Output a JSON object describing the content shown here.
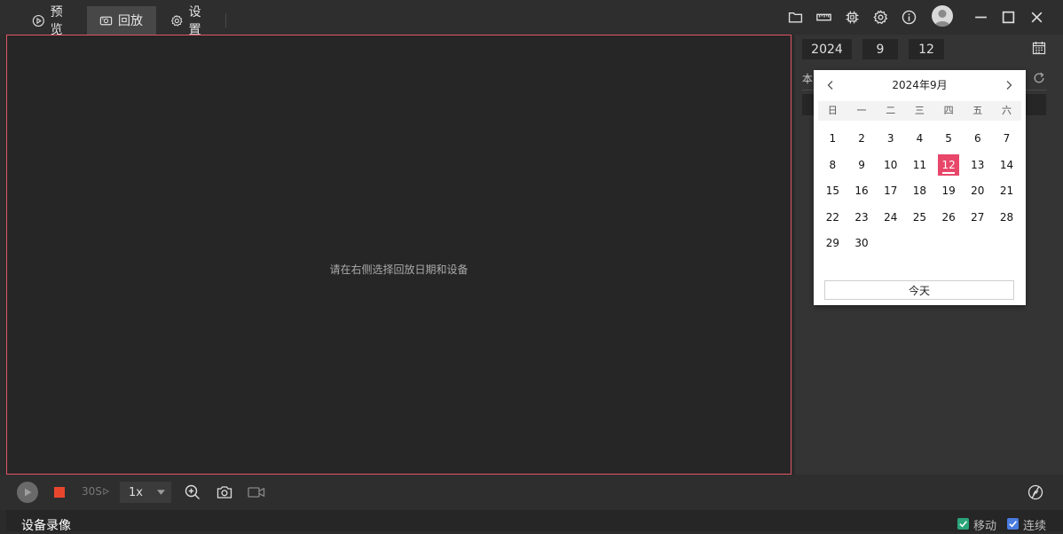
{
  "tabs": [
    {
      "label": "预览",
      "icon": "play-circle-icon"
    },
    {
      "label": "回放",
      "icon": "camera-icon"
    },
    {
      "label": "设置",
      "icon": "gear-icon"
    }
  ],
  "toolbar_icons": [
    "folder-icon",
    "ruler-icon",
    "chip-icon",
    "gear-icon",
    "info-icon",
    "avatar-icon",
    "minimize-icon",
    "maximize-icon",
    "close-icon"
  ],
  "video": {
    "placeholder": "请在右侧选择回放日期和设备"
  },
  "date": {
    "year": "2024",
    "month": "9",
    "day": "12"
  },
  "panel": {
    "partial_label": "本"
  },
  "calendar": {
    "title": "2024年9月",
    "weekdays": [
      "日",
      "一",
      "二",
      "三",
      "四",
      "五",
      "六"
    ],
    "days": [
      "1",
      "2",
      "3",
      "4",
      "5",
      "6",
      "7",
      "8",
      "9",
      "10",
      "11",
      "12",
      "13",
      "14",
      "15",
      "16",
      "17",
      "18",
      "19",
      "20",
      "21",
      "22",
      "23",
      "24",
      "25",
      "26",
      "27",
      "28",
      "29",
      "30"
    ],
    "selected": "12",
    "today_label": "今天"
  },
  "player": {
    "skip_label": "30S",
    "speed": "1x"
  },
  "footer": {
    "title": "设备录像",
    "motion_label": "移动",
    "continuous_label": "连续"
  },
  "colors": {
    "accent": "#e8476a",
    "motion": "#2aa57a",
    "continuous": "#4a7be0"
  }
}
